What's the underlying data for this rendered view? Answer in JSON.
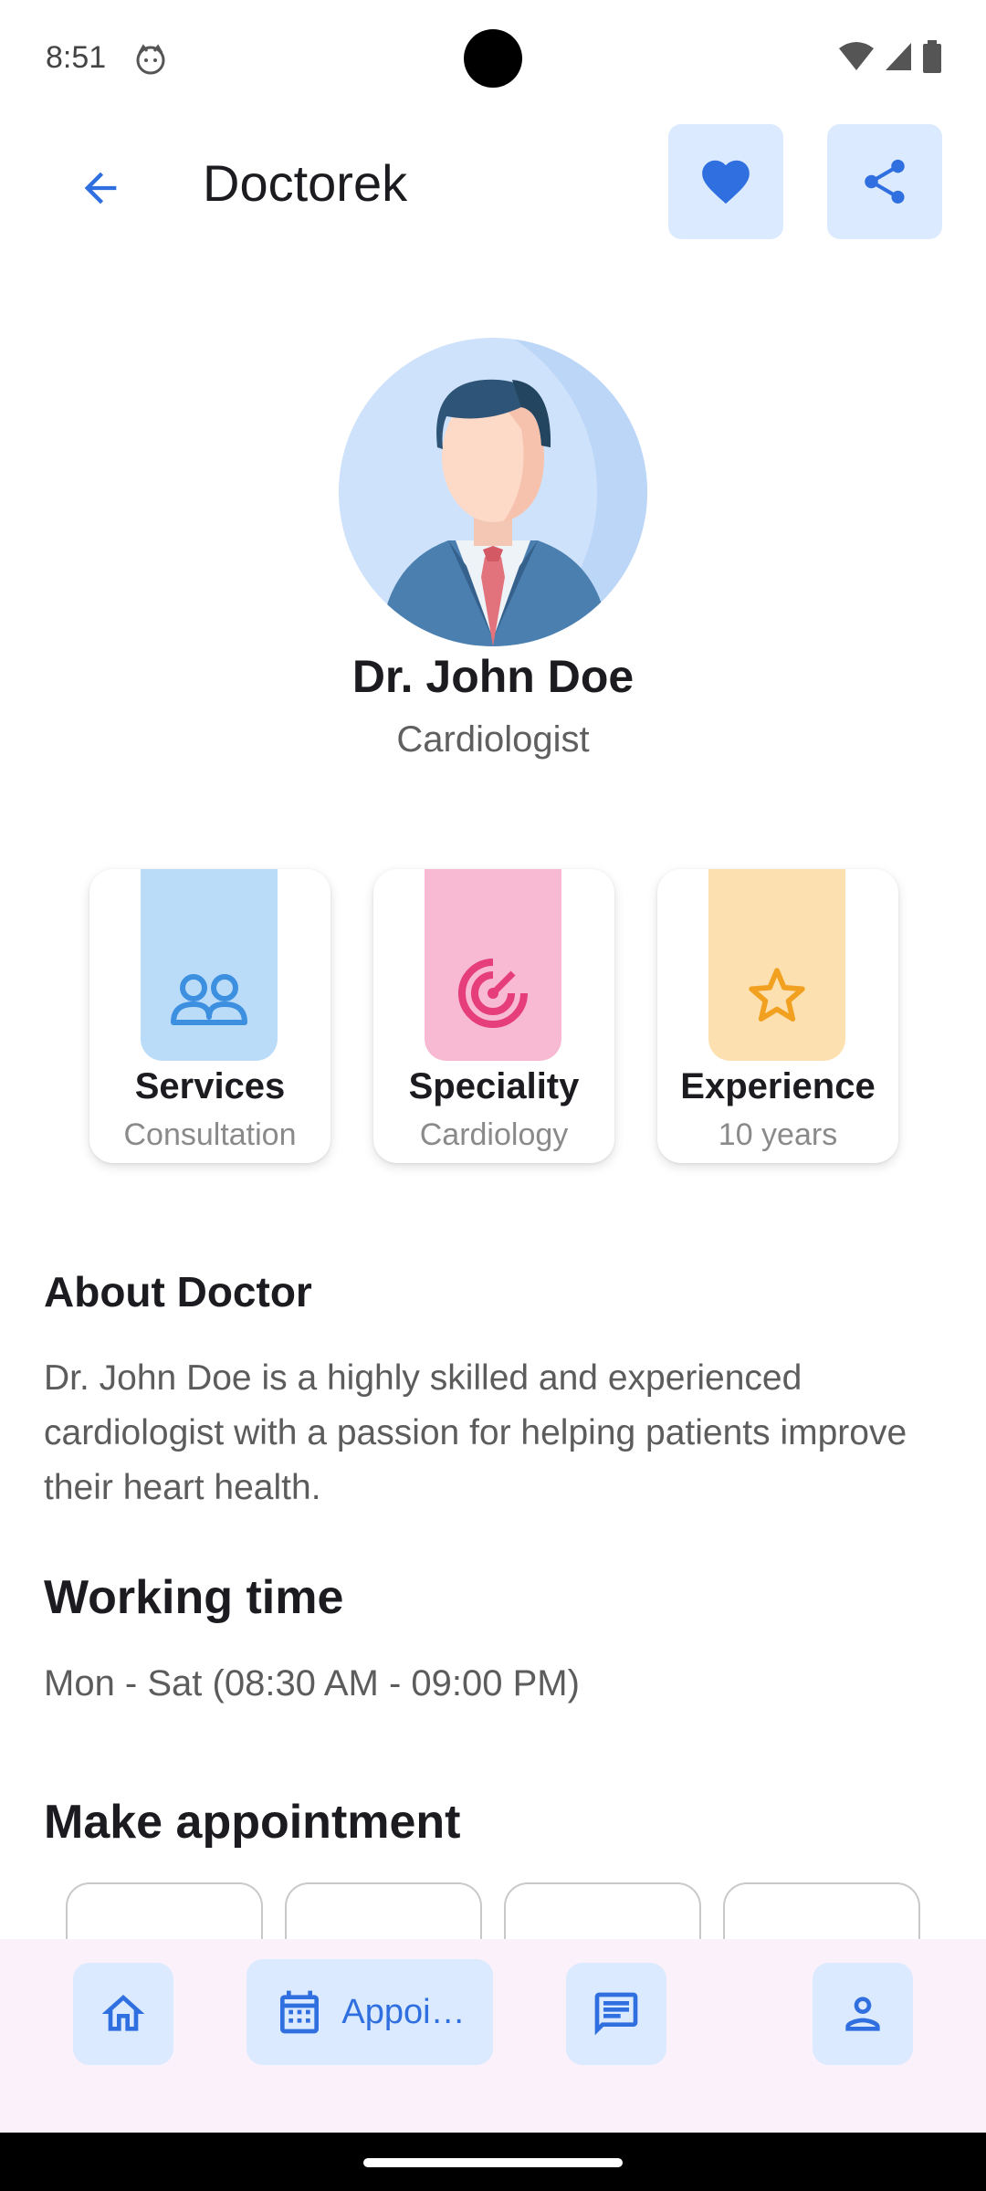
{
  "status_bar": {
    "time": "8:51"
  },
  "app_bar": {
    "title": "Doctorek"
  },
  "doctor": {
    "name": "Dr. John Doe",
    "specialty": "Cardiologist"
  },
  "stats": [
    {
      "title": "Services",
      "value": "Consultation",
      "icon": "people-icon",
      "color": "#bbdcf8"
    },
    {
      "title": "Speciality",
      "value": "Cardiology",
      "icon": "target-icon",
      "color": "#f8bad2"
    },
    {
      "title": "Experience",
      "value": "10 years",
      "icon": "star-icon",
      "color": "#fde0b0"
    }
  ],
  "about": {
    "title": "About Doctor",
    "text": "Dr. John Doe is a highly skilled and experienced cardiologist with a passion for helping patients improve their heart health."
  },
  "working_time": {
    "title": "Working time",
    "text": "Mon - Sat (08:30 AM - 09:00 PM)"
  },
  "appointment": {
    "title": "Make appointment"
  },
  "bottom_nav": {
    "items": [
      {
        "icon": "home-icon"
      },
      {
        "icon": "calendar-icon",
        "label": "Appoi…"
      },
      {
        "icon": "message-icon"
      },
      {
        "icon": "profile-icon"
      }
    ]
  },
  "colors": {
    "accent": "#2f6fe0",
    "button_bg": "#dbeafe",
    "nav_bg": "#fbf1fa"
  }
}
